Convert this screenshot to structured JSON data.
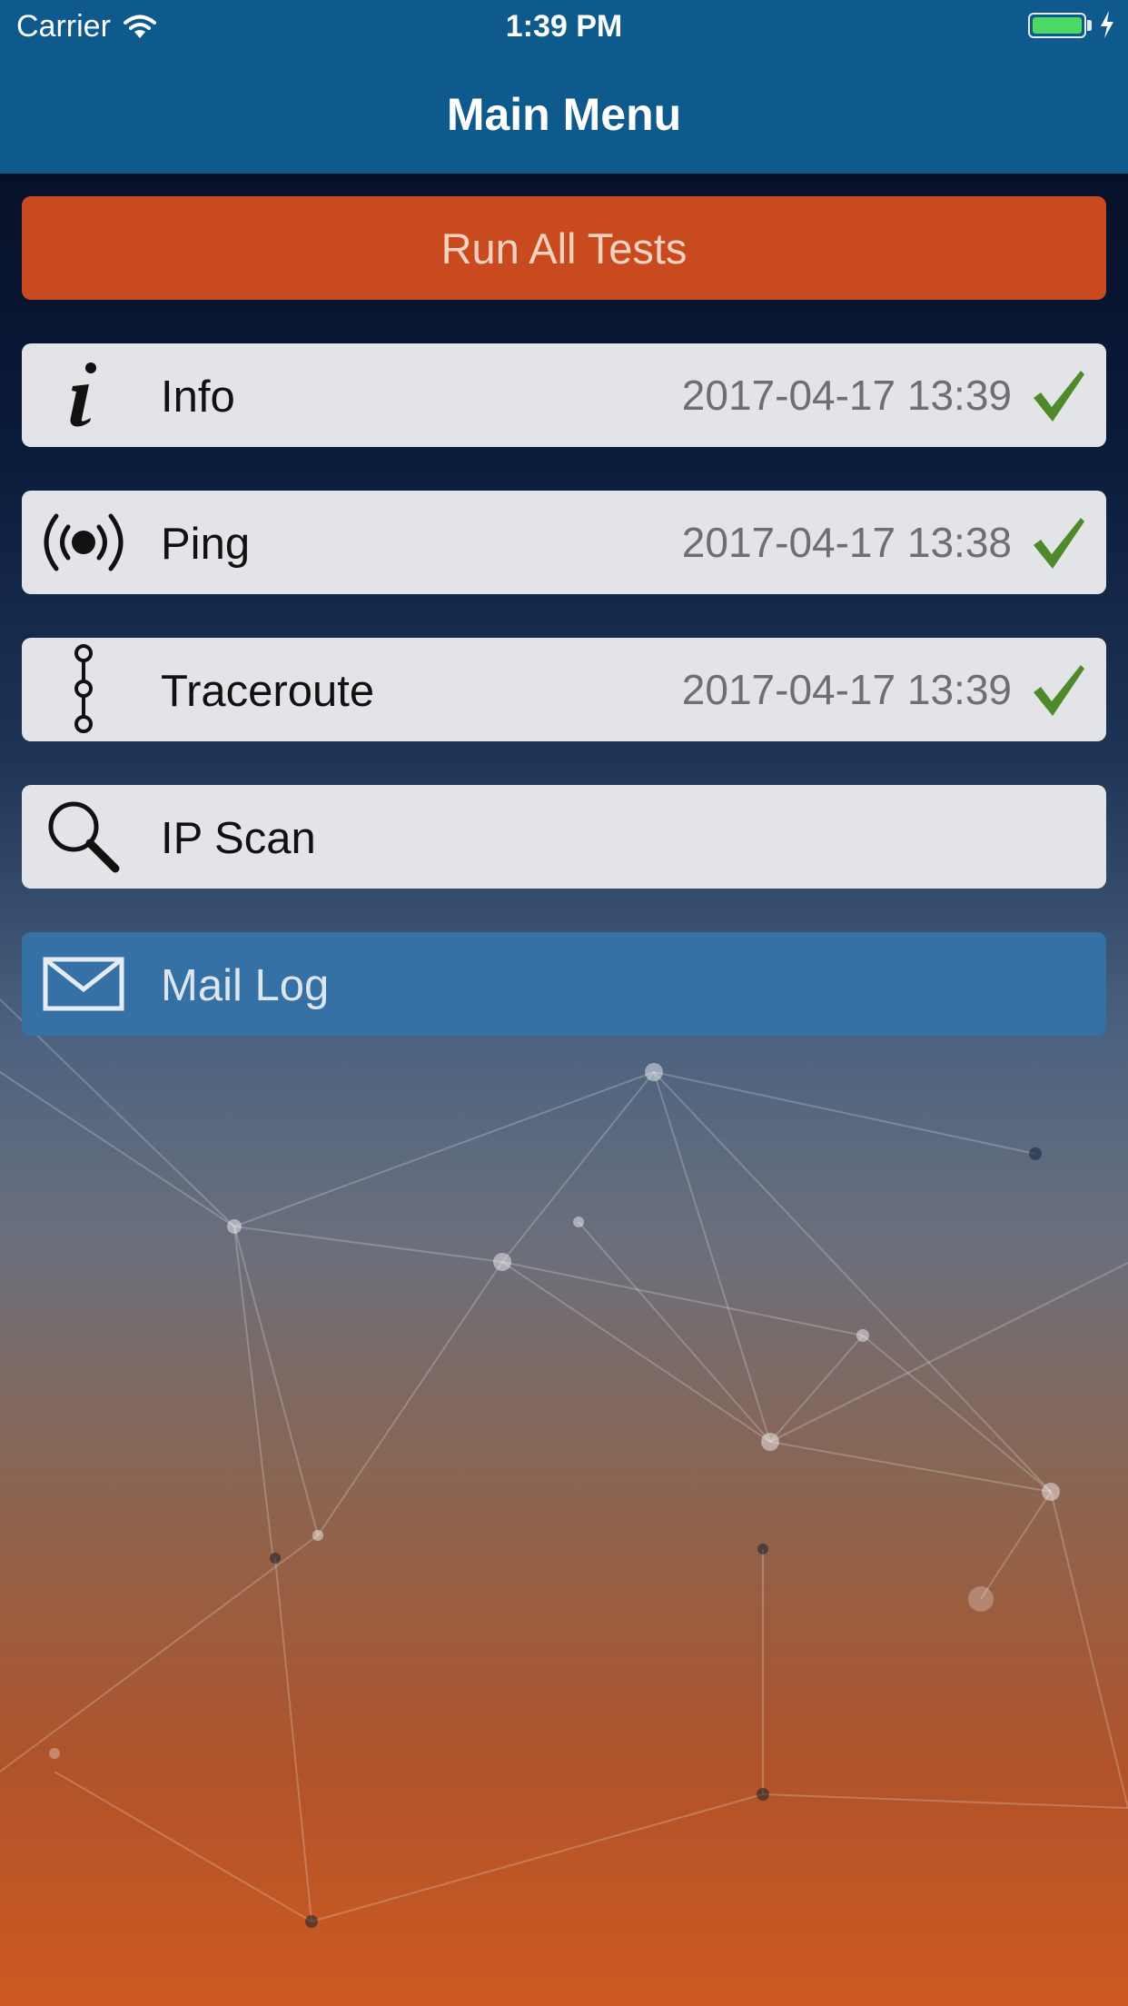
{
  "status_bar": {
    "carrier": "Carrier",
    "time": "1:39 PM"
  },
  "nav": {
    "title": "Main Menu"
  },
  "run_all": {
    "label": "Run All Tests"
  },
  "menu": {
    "items": [
      {
        "label": "Info",
        "time": "2017-04-17 13:39",
        "icon": "info-icon",
        "completed": true
      },
      {
        "label": "Ping",
        "time": "2017-04-17 13:38",
        "icon": "broadcast-icon",
        "completed": true
      },
      {
        "label": "Traceroute",
        "time": "2017-04-17 13:39",
        "icon": "traceroute-icon",
        "completed": true
      },
      {
        "label": "IP Scan",
        "icon": "search-icon",
        "completed": false
      },
      {
        "label": "Mail Log",
        "icon": "mail-icon",
        "completed": false
      }
    ]
  },
  "colors": {
    "nav": "#0f5a8c",
    "run_button": "#c84a1e",
    "row": "#e3e4e8",
    "mail_row": "#3671a5",
    "check": "#4f8a2a"
  }
}
